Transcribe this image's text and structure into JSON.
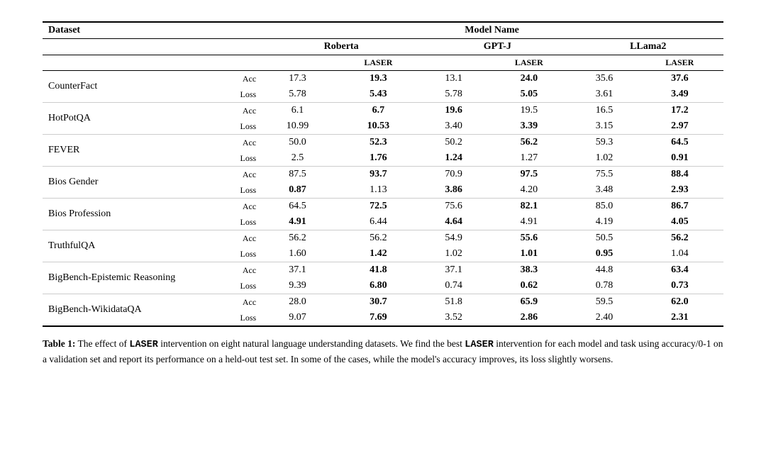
{
  "table": {
    "caption_prefix": "Table 1:",
    "caption_text": "The effect of ",
    "caption_laser": "LASER",
    "caption_rest": " intervention on eight natural language understanding datasets. We find the best ",
    "caption_laser2": "LASER",
    "caption_rest2": " intervention for each model and task using accuracy/0-1 on a validation set and report its performance on a held-out test set. In some of the cases, while the model's accuracy improves, its loss slightly worsens.",
    "headers": {
      "dataset": "Dataset",
      "model_name": "Model Name",
      "roberta": "Roberta",
      "roberta_sub": "LASER",
      "gptj": "GPT-J",
      "gptj_sub": "LASER",
      "llama2": "LLama2",
      "llama2_sub": "LASER"
    },
    "rows": [
      {
        "dataset": "CounterFact",
        "acc": [
          "17.3",
          "19.3",
          "13.1",
          "24.0",
          "35.6",
          "37.6"
        ],
        "acc_bold": [
          false,
          true,
          false,
          true,
          false,
          true
        ],
        "loss": [
          "5.78",
          "5.43",
          "5.78",
          "5.05",
          "3.61",
          "3.49"
        ],
        "loss_bold": [
          false,
          true,
          false,
          true,
          false,
          true
        ]
      },
      {
        "dataset": "HotPotQA",
        "acc": [
          "6.1",
          "6.7",
          "19.6",
          "19.5",
          "16.5",
          "17.2"
        ],
        "acc_bold": [
          false,
          true,
          true,
          false,
          false,
          true
        ],
        "loss": [
          "10.99",
          "10.53",
          "3.40",
          "3.39",
          "3.15",
          "2.97"
        ],
        "loss_bold": [
          false,
          true,
          false,
          true,
          false,
          true
        ]
      },
      {
        "dataset": "FEVER",
        "acc": [
          "50.0",
          "52.3",
          "50.2",
          "56.2",
          "59.3",
          "64.5"
        ],
        "acc_bold": [
          false,
          true,
          false,
          true,
          false,
          true
        ],
        "loss": [
          "2.5",
          "1.76",
          "1.24",
          "1.27",
          "1.02",
          "0.91"
        ],
        "loss_bold": [
          false,
          true,
          true,
          false,
          false,
          true
        ]
      },
      {
        "dataset": "Bios Gender",
        "acc": [
          "87.5",
          "93.7",
          "70.9",
          "97.5",
          "75.5",
          "88.4"
        ],
        "acc_bold": [
          false,
          true,
          false,
          true,
          false,
          true
        ],
        "loss": [
          "0.87",
          "1.13",
          "3.86",
          "4.20",
          "3.48",
          "2.93"
        ],
        "loss_bold": [
          true,
          false,
          true,
          false,
          false,
          true
        ]
      },
      {
        "dataset": "Bios Profession",
        "acc": [
          "64.5",
          "72.5",
          "75.6",
          "82.1",
          "85.0",
          "86.7"
        ],
        "acc_bold": [
          false,
          true,
          false,
          true,
          false,
          true
        ],
        "loss": [
          "4.91",
          "6.44",
          "4.64",
          "4.91",
          "4.19",
          "4.05"
        ],
        "loss_bold": [
          true,
          false,
          true,
          false,
          false,
          true
        ]
      },
      {
        "dataset": "TruthfulQA",
        "acc": [
          "56.2",
          "56.2",
          "54.9",
          "55.6",
          "50.5",
          "56.2"
        ],
        "acc_bold": [
          false,
          false,
          false,
          true,
          false,
          true
        ],
        "loss": [
          "1.60",
          "1.42",
          "1.02",
          "1.01",
          "0.95",
          "1.04"
        ],
        "loss_bold": [
          false,
          true,
          false,
          true,
          true,
          false
        ]
      },
      {
        "dataset": "BigBench-Epistemic Reasoning",
        "acc": [
          "37.1",
          "41.8",
          "37.1",
          "38.3",
          "44.8",
          "63.4"
        ],
        "acc_bold": [
          false,
          true,
          false,
          true,
          false,
          true
        ],
        "loss": [
          "9.39",
          "6.80",
          "0.74",
          "0.62",
          "0.78",
          "0.73"
        ],
        "loss_bold": [
          false,
          true,
          false,
          true,
          false,
          true
        ]
      },
      {
        "dataset": "BigBench-WikidataQA",
        "acc": [
          "28.0",
          "30.7",
          "51.8",
          "65.9",
          "59.5",
          "62.0"
        ],
        "acc_bold": [
          false,
          true,
          false,
          true,
          false,
          true
        ],
        "loss": [
          "9.07",
          "7.69",
          "3.52",
          "2.86",
          "2.40",
          "2.31"
        ],
        "loss_bold": [
          false,
          true,
          false,
          true,
          false,
          true
        ]
      }
    ]
  }
}
